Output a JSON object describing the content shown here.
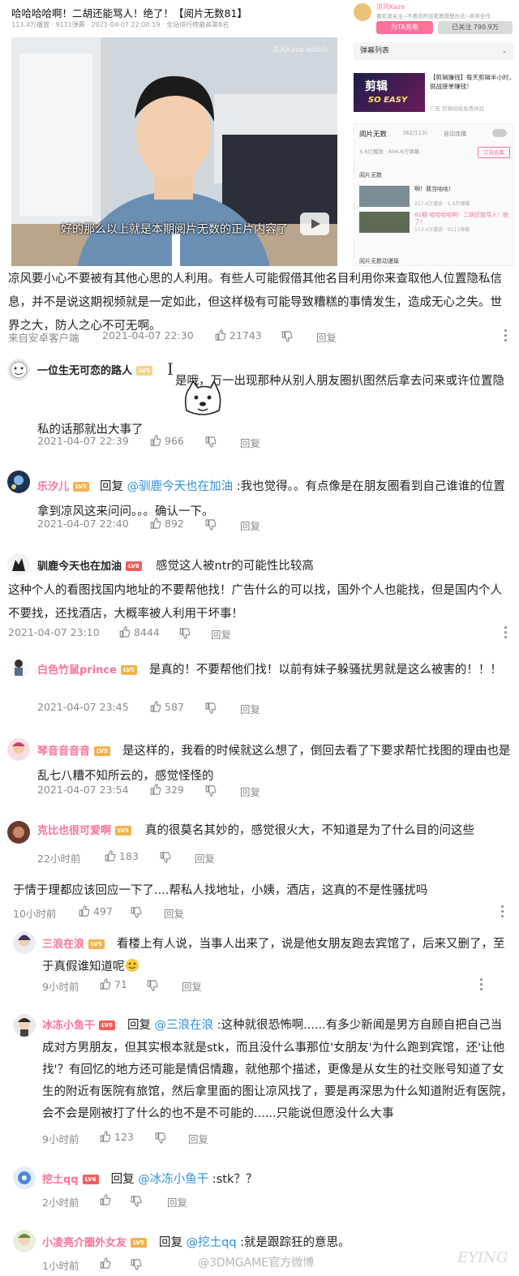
{
  "video": {
    "title": "哈哈哈哈啊！二胡还能骂人！绝了！【阅片无数81】",
    "meta": "113.4万播放 · 9111弹幕 · 2021-04-07 22:00:19 · 全站排行榜最高第8名",
    "subtitle": "好的那么以上就是本期阅片无数的正片内容了",
    "watermark": "凉风Kaze bilibili"
  },
  "sidebar": {
    "up_name": "凉风Kaze",
    "up_desc": "喜欢请关注~不喜欢的话我再想想办法~商务合作",
    "charge_btn": "为TA充电",
    "follow_btn": "已关注 790.9万",
    "danmu_list": "弹幕列表",
    "ad_title": "剪辑",
    "ad_sub": "SO EASY",
    "ad_text": "【剪辑赚钱】每天剪辑半小时，挑战接单赚钱！",
    "ad_foot": "广告 剪辑班级免费体验",
    "collection_title": "阅片无数",
    "collection_count": "(82/113)",
    "autoplay_label": "自动连播",
    "collection_meta": "4.6亿播放 · 604.8万弹幕",
    "subscribe_btn": "订阅合集",
    "section_label": "阅片无数",
    "items": [
      {
        "title": "啊！我当咕咕！",
        "stats": "257.4万播放 · 1.4万弹幕"
      },
      {
        "title": "81期 哈哈哈哈啊！二胡还能骂人！绝了！",
        "stats": "113.4万播放 · 9111弹幕"
      }
    ],
    "bottom_label": "阅片无数动漫篇"
  },
  "comments": {
    "top_text": "凉风要小心不要被有其他心思的人利用。有些人可能假借其他名目利用你来查取他人位置隐私信息，并不是说这期视频就是一定如此，但这样极有可能导致糟糕的事情发生，造成无心之失。世界之大，防人之心不可无啊。",
    "top_meta": {
      "source": "来自安卓客户端",
      "time": "2021-04-07 22:30",
      "likes": "21743",
      "reply": "回复"
    },
    "c1": {
      "user": "一位生无可恋的路人",
      "level": "LV5",
      "text": "是哦，万一出现那种从别人朋友圈扒图然后拿去问来或许位置隐私的话那就出大事了",
      "time": "2021-04-07 22:39",
      "likes": "966",
      "reply": "回复"
    },
    "c2": {
      "user": "乐汐儿",
      "level": "LV5",
      "prefix": "回复 ",
      "mention": "@驯鹿今天也在加油",
      "text": " :我也觉得。。有点像是在朋友圈看到自己谁谁的位置拿到凉风这来问问。。。确认一下。",
      "time": "2021-04-07 22:40",
      "likes": "892",
      "reply": "回复"
    },
    "c3": {
      "user": "驯鹿今天也在加油",
      "level": "LV6",
      "text": "感觉这人被ntr的可能性比较高"
    },
    "c4": {
      "text": "这种个人的看图找国内地址的不要帮他找！广告什么的可以找，国外个人也能找，但是国内个人不要找，还找酒店，大概率被人利用干坏事！",
      "time": "2021-04-07 23:10",
      "likes": "8444",
      "reply": "回复"
    },
    "c5": {
      "user": "白色竹鼠prince",
      "level": "LV5",
      "text": "是真的！不要帮他们找！以前有妹子躲骚扰男就是这么被害的！！！",
      "time": "2021-04-07 23:45",
      "likes": "587",
      "reply": "回复"
    },
    "c6": {
      "user": "琴音音音音",
      "level": "LV5",
      "text": "是这样的，我看的时候就这么想了，倒回去看了下要求帮忙找图的理由也是乱七八糟不知所云的，感觉怪怪的",
      "time": "2021-04-07 23:54",
      "likes": "329",
      "reply": "回复"
    },
    "c7": {
      "user": "克比也很可爱啊",
      "level": "LV5",
      "text": "真的很莫名其妙的，感觉很火大，不知道是为了什么目的问这些",
      "time": "22小时前",
      "likes": "183",
      "reply": "回复"
    },
    "c8": {
      "text": "于情于理都应该回应一下了....帮私人找地址，小姨，酒店，这真的不是性骚扰吗",
      "time": "10小时前",
      "likes": "497",
      "reply": "回复"
    },
    "c9": {
      "user": "三浪在浪",
      "level": "LV5",
      "text": "看楼上有人说，当事人出来了，说是他女朋友跑去宾馆了，后来又删了，至于真假谁知道呢",
      "time": "9小时前",
      "likes": "71",
      "reply": "回复"
    },
    "c10": {
      "user": "冰冻小鱼干",
      "level": "LV6",
      "prefix": "回复 ",
      "mention": "@三浪在浪",
      "text": " :这种就很恐怖啊......有多少新闻是男方自顾自把自己当成对方男朋友，但其实根本就是stk，而且没什么事那位'女朋友'为什么跑到宾馆，还'让他找'？有回忆的地方还可能是情侣情趣，就他那个描述，更像是从女生的社交账号知道了女生的附近有医院有旅馆，然后拿里面的图让凉风找了，要是再深思为什么知道附近有医院，会不会是刚被打了什么的也不是不可能的......只能说但愿没什么大事",
      "time": "9小时前",
      "likes": "123",
      "reply": "回复"
    },
    "c11": {
      "user": "挖土qq",
      "level": "LV6",
      "prefix": "回复 ",
      "mention": "@冰冻小鱼干",
      "text": " :stk？？",
      "time": "2小时前",
      "reply": "回复"
    },
    "c12": {
      "user": "小凌亮介圈外女友",
      "level": "LV5",
      "prefix": "回复 ",
      "mention": "@挖土qq",
      "text": " :就是跟踪狂的意思。",
      "time": "1小时前",
      "reply": "回复"
    }
  },
  "watermark": "@3DMGAME官方微博",
  "colors": {
    "accent_pink": "#fb7299",
    "mention_blue": "#2f8fd8",
    "meta_gray": "#8a8a8a",
    "level_badge": "#f2b24f"
  }
}
